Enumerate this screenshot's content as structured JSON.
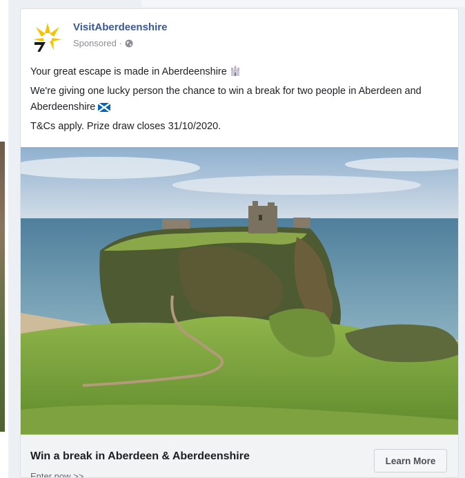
{
  "post": {
    "page_name": "VisitAberdeenshire",
    "sponsored_label": "Sponsored",
    "separator": "·",
    "audience_icon": "globe-icon",
    "logo_icon": "visitaberdeenshire-logo",
    "text_lines": [
      "Your great escape is made in Aberdeenshire",
      "We're giving one lucky person the chance to win a break for two people in Aberdeen and Aberdeenshire",
      "T&Cs apply. Prize draw closes 31/10/2020."
    ],
    "emojis": [
      "castle-emoji",
      "scotland-flag-emoji"
    ]
  },
  "image": {
    "subject": "castle-on-clifftop-photo"
  },
  "link": {
    "headline": "Win a break in Aberdeen & Aberdeenshire",
    "description": "Enter now >>",
    "cta_label": "Learn More"
  },
  "colors": {
    "page_name": "#385898",
    "logo_yellow": "#f5c400",
    "logo_dark": "#1a1a1a",
    "footer_bg": "#f2f3f5"
  }
}
